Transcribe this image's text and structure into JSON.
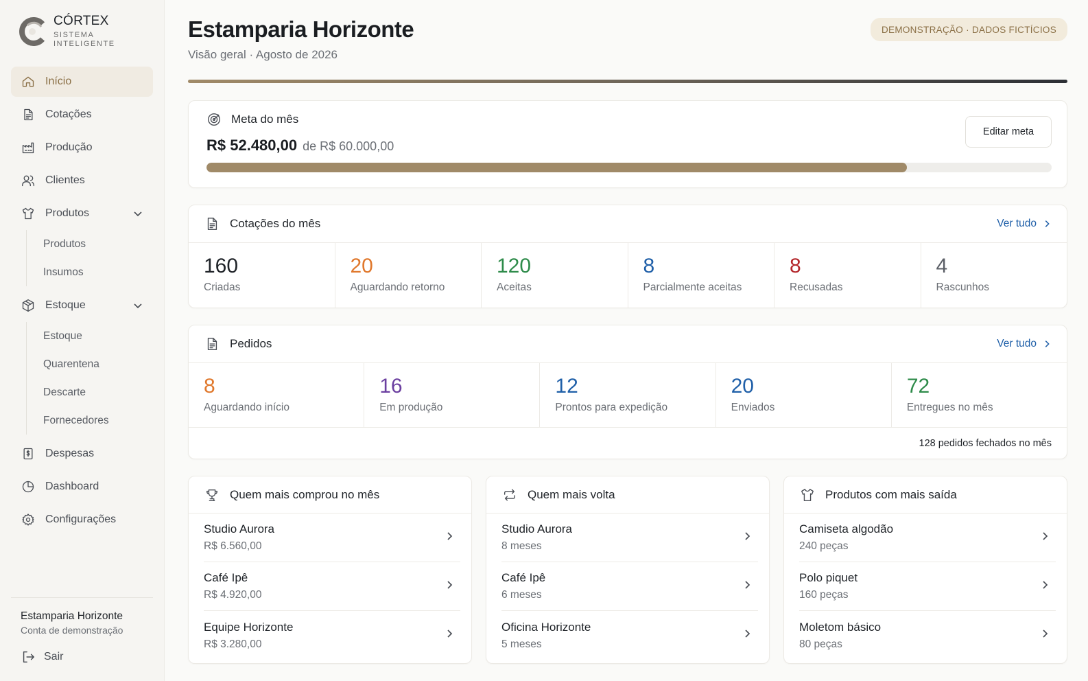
{
  "brand": {
    "name": "CÓRTEX",
    "subtitle": "SISTEMA INTELIGENTE"
  },
  "sidebar": {
    "items": [
      {
        "label": "Início",
        "icon": "home-icon",
        "active": true
      },
      {
        "label": "Cotações",
        "icon": "document-icon"
      },
      {
        "label": "Produção",
        "icon": "factory-icon"
      },
      {
        "label": "Clientes",
        "icon": "users-icon"
      },
      {
        "label": "Produtos",
        "icon": "shirt-icon",
        "expanded": true
      },
      {
        "label": "Estoque",
        "icon": "box-icon",
        "expanded": true
      },
      {
        "label": "Despesas",
        "icon": "dollar-receipt-icon"
      },
      {
        "label": "Dashboard",
        "icon": "pie-chart-icon"
      },
      {
        "label": "Configurações",
        "icon": "gear-icon"
      }
    ],
    "produtos_sub": [
      "Produtos",
      "Insumos"
    ],
    "estoque_sub": [
      "Estoque",
      "Quarentena",
      "Descarte",
      "Fornecedores"
    ],
    "footer": {
      "name": "Estamparia Horizonte",
      "subtitle": "Conta de demonstração",
      "logout": "Sair"
    }
  },
  "header": {
    "title": "Estamparia Horizonte",
    "subtitle": "Visão geral · Agosto de 2026",
    "badge": "DEMONSTRAÇÃO · DADOS FICTÍCIOS"
  },
  "meta": {
    "title": "Meta do mês",
    "amount": "R$ 52.480,00",
    "of_label": "de R$ 60.000,00",
    "progress": 0.8287,
    "edit_label": "Editar meta",
    "color": "#a08a68"
  },
  "cotacoes": {
    "title": "Cotações do mês",
    "see_all": "Ver tudo",
    "stats": [
      {
        "value": "160",
        "label": "Criadas",
        "color": "#1f2328"
      },
      {
        "value": "20",
        "label": "Aguardando retorno",
        "color": "#e0782c"
      },
      {
        "value": "120",
        "label": "Aceitas",
        "color": "#2e8b4a"
      },
      {
        "value": "8",
        "label": "Parcialmente aceitas",
        "color": "#1f5fa8"
      },
      {
        "value": "8",
        "label": "Recusadas",
        "color": "#b3262a"
      },
      {
        "value": "4",
        "label": "Rascunhos",
        "color": "#5b5f66"
      }
    ]
  },
  "pedidos": {
    "title": "Pedidos",
    "see_all": "Ver tudo",
    "stats": [
      {
        "value": "8",
        "label": "Aguardando início",
        "color": "#e0782c"
      },
      {
        "value": "16",
        "label": "Em produção",
        "color": "#6b3fa0"
      },
      {
        "value": "12",
        "label": "Prontos para expedição",
        "color": "#1f5fa8"
      },
      {
        "value": "20",
        "label": "Enviados",
        "color": "#1f5fa8"
      },
      {
        "value": "72",
        "label": "Entregues no mês",
        "color": "#2e8b4a"
      }
    ],
    "footer": "128 pedidos fechados no mês"
  },
  "top_buyers": {
    "title": "Quem mais comprou no mês",
    "items": [
      {
        "name": "Studio Aurora",
        "sub": "R$ 6.560,00"
      },
      {
        "name": "Café Ipê",
        "sub": "R$ 4.920,00"
      },
      {
        "name": "Equipe Horizonte",
        "sub": "R$ 3.280,00"
      }
    ]
  },
  "returning": {
    "title": "Quem mais volta",
    "items": [
      {
        "name": "Studio Aurora",
        "sub": "8 meses"
      },
      {
        "name": "Café Ipê",
        "sub": "6 meses"
      },
      {
        "name": "Oficina Horizonte",
        "sub": "5 meses"
      }
    ]
  },
  "top_products": {
    "title": "Produtos com mais saída",
    "items": [
      {
        "name": "Camiseta algodão",
        "sub": "240 peças"
      },
      {
        "name": "Polo piquet",
        "sub": "160 peças"
      },
      {
        "name": "Moletom básico",
        "sub": "80 peças"
      }
    ]
  }
}
